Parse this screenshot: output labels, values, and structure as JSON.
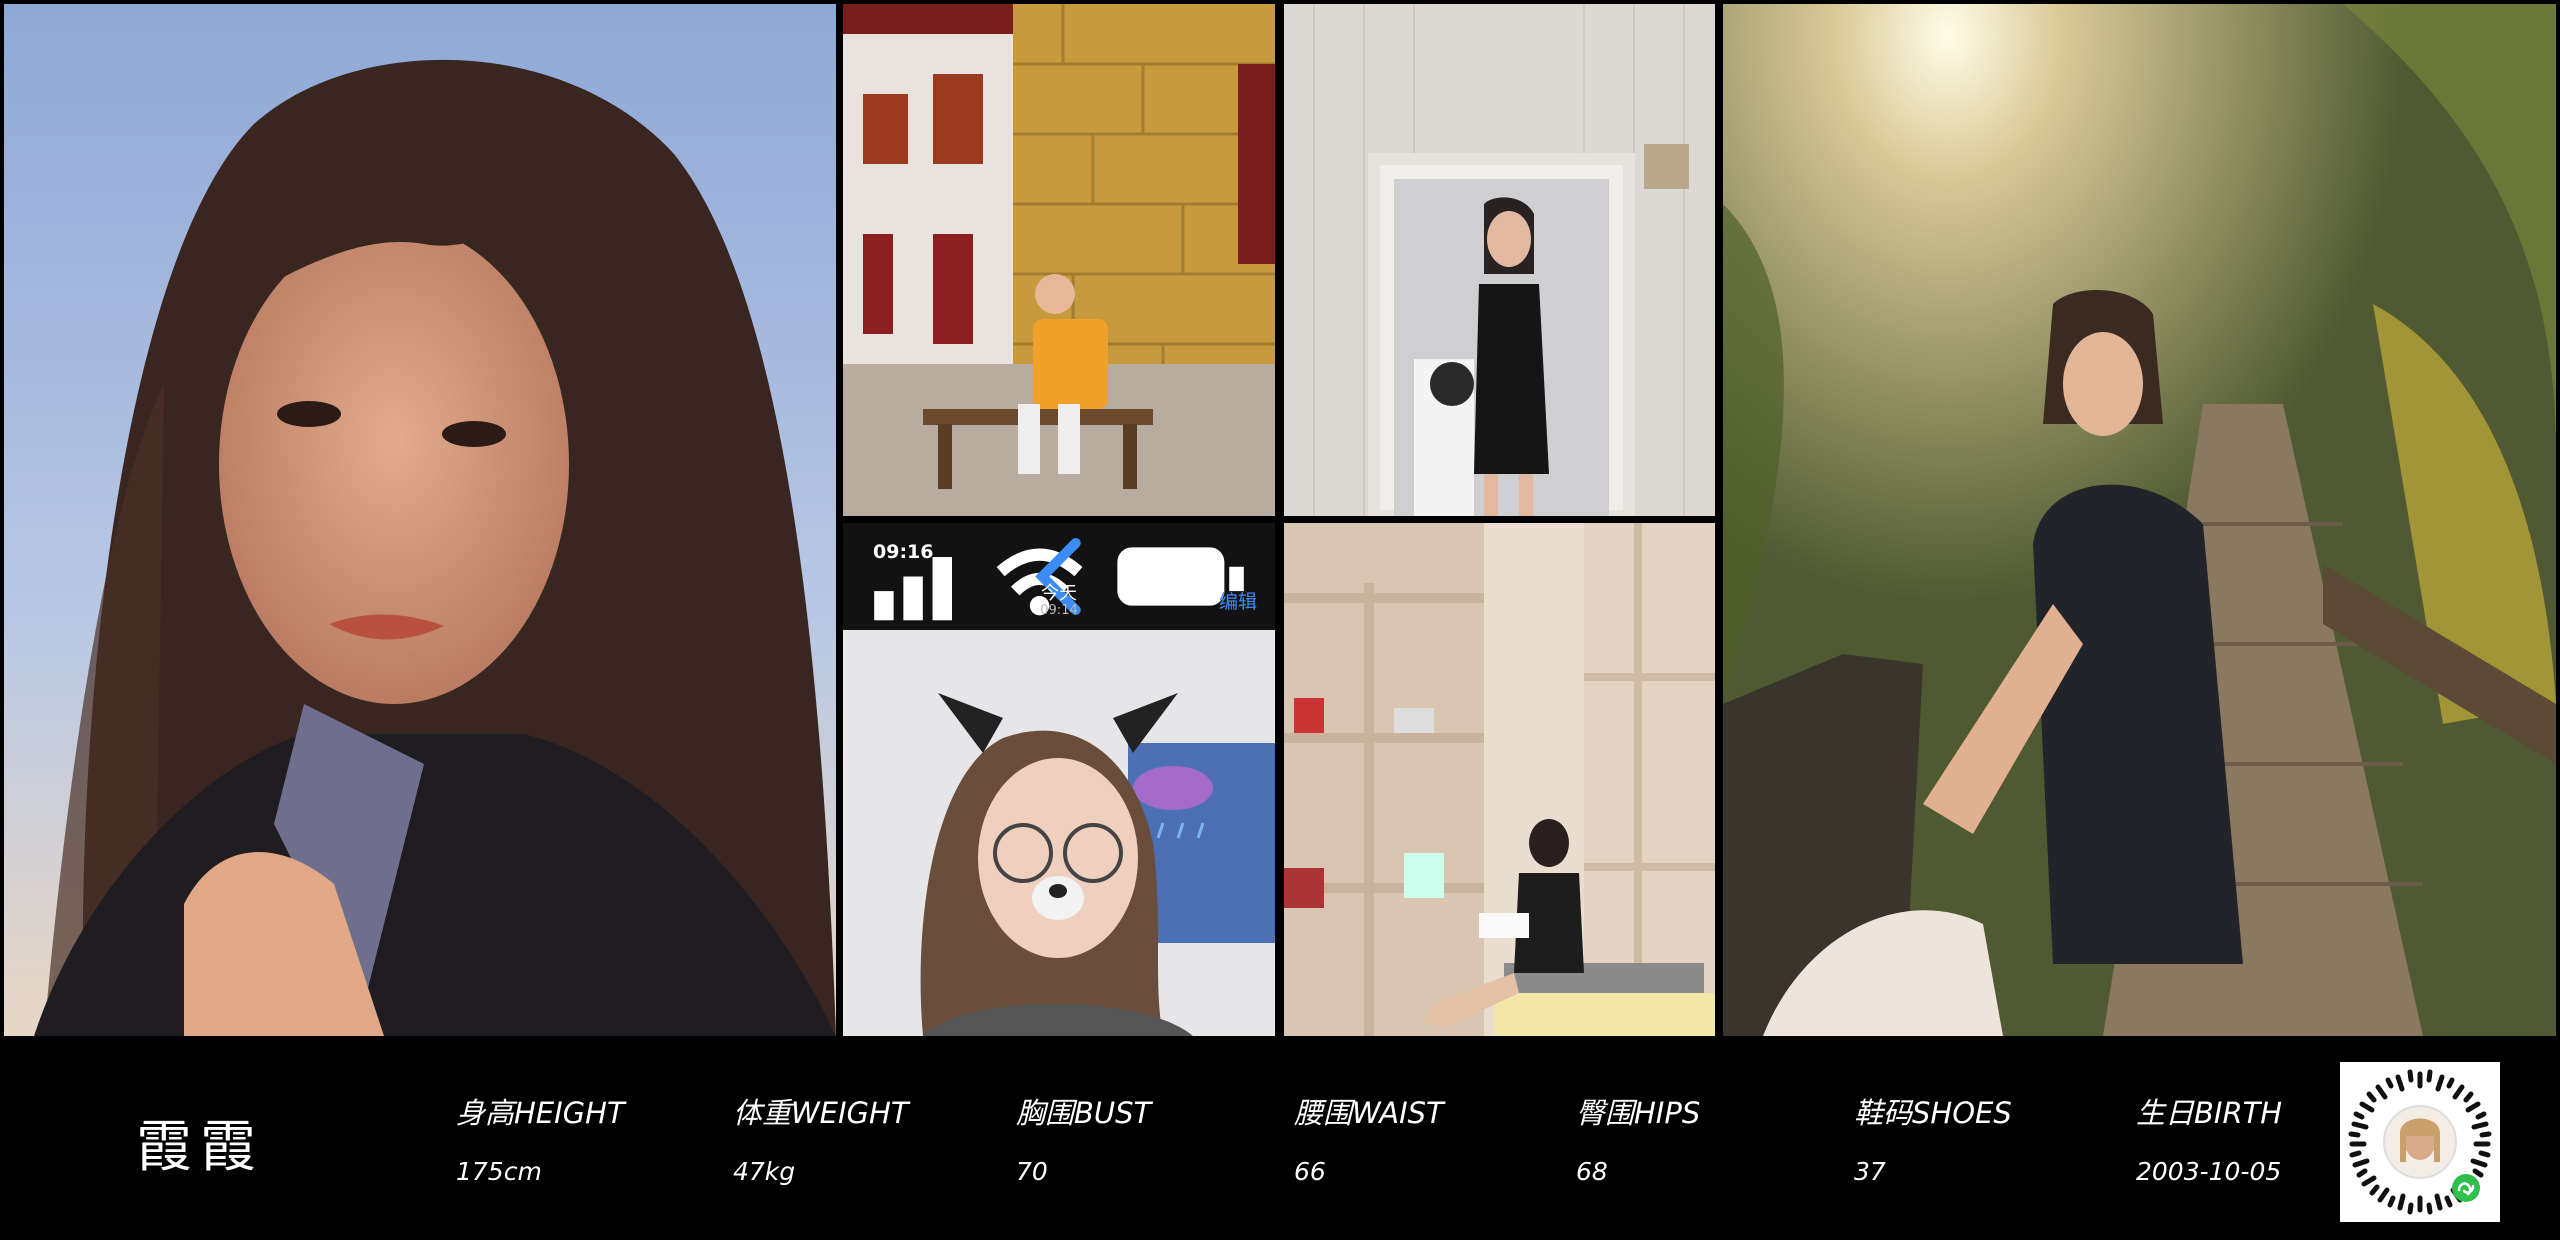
{
  "phone_ui": {
    "status_time": "09:16",
    "title": "今天",
    "subtitle_time": "09:14",
    "edit_label": "编辑"
  },
  "profile": {
    "name": "霞霞",
    "stats": [
      {
        "label": "身高HEIGHT",
        "value": "175cm"
      },
      {
        "label": "体重WEIGHT",
        "value": "47kg"
      },
      {
        "label": "胸围BUST",
        "value": "70"
      },
      {
        "label": "腰围WAIST",
        "value": "66"
      },
      {
        "label": "臀围HIPS",
        "value": "68"
      },
      {
        "label": "鞋码SHOES",
        "value": "37"
      },
      {
        "label": "生日BIRTH",
        "value": "2003-10-05"
      }
    ]
  },
  "colors": {
    "background": "#000000",
    "text": "#ffffff",
    "ios_blue": "#3b8df5",
    "wechat_green": "#2fbf4a"
  },
  "icons": {
    "back": "chevron-left-icon",
    "status": "signal-wifi-battery-icon",
    "mini_program": "wechat-mini-program-icon"
  }
}
